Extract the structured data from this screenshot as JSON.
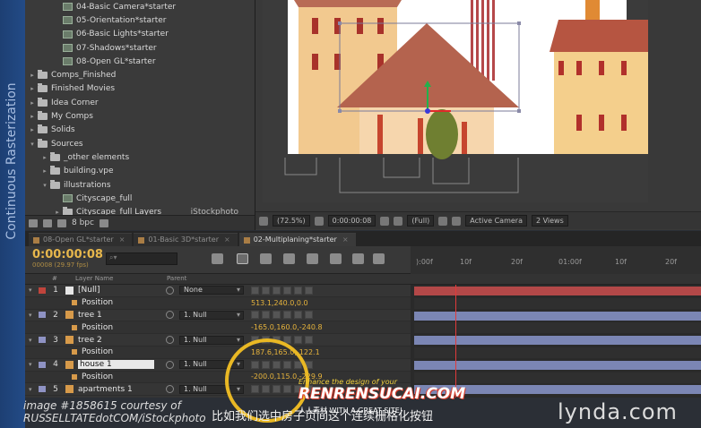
{
  "side_label": "Continuous Rasterization",
  "project_panel": {
    "items": [
      {
        "label": "04-Basic Camera*starter",
        "type": "comp",
        "indent": 2
      },
      {
        "label": "05-Orientation*starter",
        "type": "comp",
        "indent": 2
      },
      {
        "label": "06-Basic Lights*starter",
        "type": "comp",
        "indent": 2
      },
      {
        "label": "07-Shadows*starter",
        "type": "comp",
        "indent": 2
      },
      {
        "label": "08-Open GL*starter",
        "type": "comp",
        "indent": 2
      },
      {
        "label": "Comps_Finished",
        "type": "folder",
        "indent": 0
      },
      {
        "label": "Finished Movies",
        "type": "folder",
        "indent": 0
      },
      {
        "label": "Idea Corner",
        "type": "folder",
        "indent": 0
      },
      {
        "label": "My Comps",
        "type": "folder",
        "indent": 0
      },
      {
        "label": "Solids",
        "type": "folder",
        "indent": 0
      },
      {
        "label": "Sources",
        "type": "folder",
        "indent": 0,
        "expanded": true
      },
      {
        "label": "_other elements",
        "type": "folder",
        "indent": 1
      },
      {
        "label": "building.vpe",
        "type": "folder",
        "indent": 1
      },
      {
        "label": "illustrations",
        "type": "folder",
        "indent": 1,
        "expanded": true
      },
      {
        "label": "Cityscape_full",
        "type": "comp",
        "indent": 2
      },
      {
        "label": "Cityscape_full Layers",
        "type": "folder",
        "indent": 2,
        "extra": "iStockphoto"
      }
    ],
    "bit_depth": "8 bpc"
  },
  "viewer_toolbar": {
    "zoom": "(72.5%)",
    "timecode": "0:00:00:08",
    "resolution": "(Full)",
    "camera": "Active Camera",
    "views": "2 Views"
  },
  "tabs": [
    {
      "label": "08-Open GL*starter",
      "active": false
    },
    {
      "label": "01-Basic 3D*starter",
      "active": false
    },
    {
      "label": "02-Multiplaning*starter",
      "active": true
    }
  ],
  "timeline": {
    "time": "0:00:00:08",
    "fps": "00008 (29.97 fps)",
    "search_placeholder": "",
    "columns": {
      "num": "#",
      "name": "Layer Name",
      "parent": "Parent"
    },
    "ruler": [
      "):00f",
      "10f",
      "20f",
      "01:00f",
      "10f",
      "20f"
    ],
    "playhead_fraction": 0.155,
    "layers": [
      {
        "num": "1",
        "name": "[Null]",
        "parent": "None",
        "color": "#c0443c",
        "icon": "#e6e6e6",
        "bar": "null"
      },
      {
        "sub": true,
        "name": "Position",
        "value": "513.1,240.0,0.0"
      },
      {
        "num": "2",
        "name": "tree 1",
        "parent": "1. Null",
        "color": "#8f93c4",
        "icon": "#d79a4a",
        "bar": "layer"
      },
      {
        "sub": true,
        "name": "Position",
        "value": "-165.0,160.0,-240.8"
      },
      {
        "num": "3",
        "name": "tree 2",
        "parent": "1. Null",
        "color": "#8f93c4",
        "icon": "#d79a4a",
        "bar": "layer"
      },
      {
        "sub": true,
        "name": "Position",
        "value": "187.6,165.0,-122.1"
      },
      {
        "num": "4",
        "name": "house 1",
        "parent": "1. Null",
        "color": "#8f93c4",
        "icon": "#d79a4a",
        "bar": "layer",
        "selected": true
      },
      {
        "sub": true,
        "name": "Position",
        "value": "-200.0,115.0,-229.9"
      },
      {
        "num": "5",
        "name": "apartments 1",
        "parent": "1. Null",
        "color": "#8f93c4",
        "icon": "#d79a4a",
        "bar": "layer"
      }
    ]
  },
  "captions": {
    "credit_line1": "image #1858615 courtesy of",
    "credit_line2": "RUSSELLTATEdotCOM/iStockphoto",
    "chinese_subtitle": "比如我们选中房子页间这个连续栅格化按钮",
    "brand": "lynda.com",
    "watermark_top": "Enhance the design of your",
    "watermark_main": "RENRENSUCAI.COM",
    "watermark_sub": "人人素材 WITH A GREAT SITE!"
  },
  "colors": {
    "accent_time": "#e7b74c",
    "playhead": "#e03a3a",
    "highlight_ring": "#e9b824"
  }
}
